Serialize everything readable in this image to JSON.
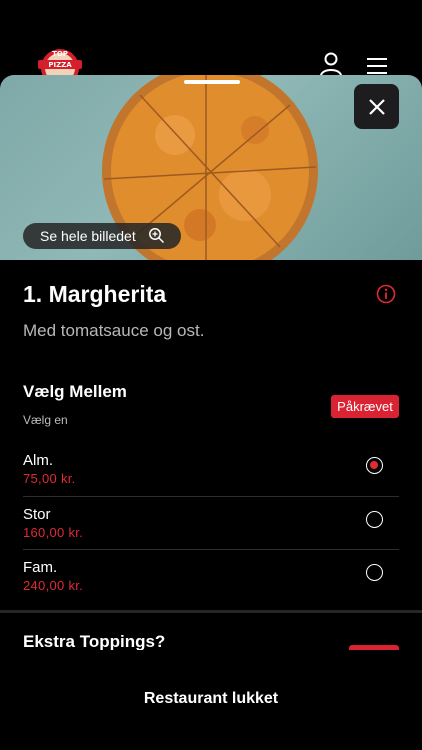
{
  "header": {
    "logo_text_top": "TOP",
    "logo_text_bottom": "PIZZA"
  },
  "hero": {
    "see_image_label": "Se hele billedet"
  },
  "product": {
    "title": "1. Margherita",
    "description": "Med tomatsauce og ost."
  },
  "size_section": {
    "title": "Vælg Mellem",
    "subtitle": "Vælg en",
    "required_badge": "Påkrævet",
    "options": [
      {
        "name": "Alm.",
        "price": "75,00 kr.",
        "selected": true
      },
      {
        "name": "Stor",
        "price": "160,00 kr.",
        "selected": false
      },
      {
        "name": "Fam.",
        "price": "240,00 kr.",
        "selected": false
      }
    ]
  },
  "toppings_section": {
    "title": "Ekstra Toppings?"
  },
  "footer": {
    "status": "Restaurant lukket"
  },
  "colors": {
    "accent": "#e02a35",
    "badge": "#d92333",
    "background": "#000000"
  }
}
